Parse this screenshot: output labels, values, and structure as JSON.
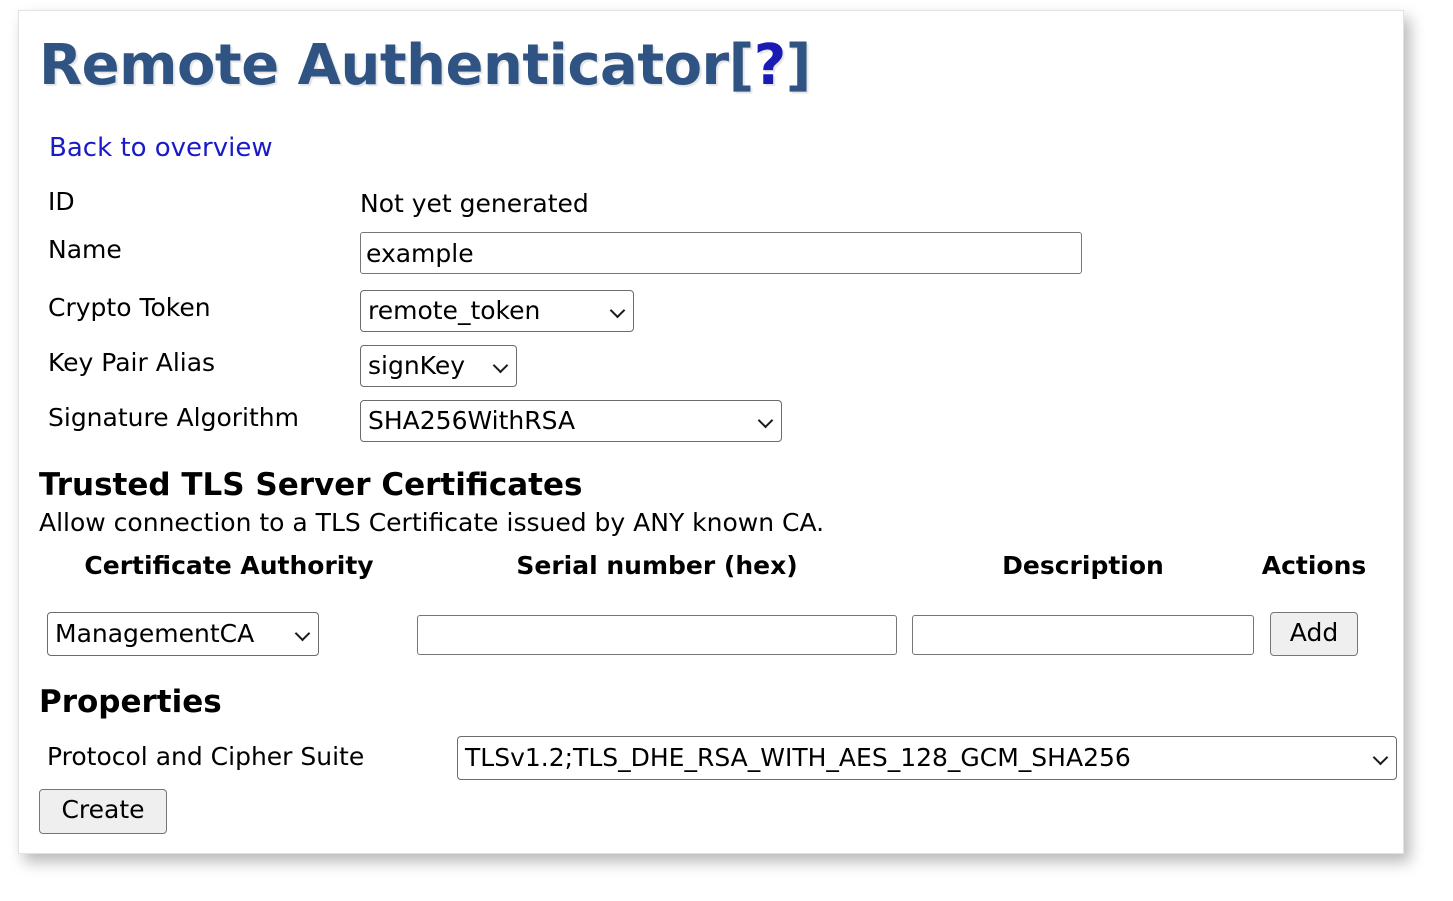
{
  "window": {
    "title_main": "Remote Authenticator",
    "title_help_open": "[",
    "title_help_mark": "?",
    "title_help_close": "]"
  },
  "nav": {
    "back_link": "Back to overview"
  },
  "form": {
    "fields": [
      {
        "label": "ID",
        "type": "static",
        "value": "Not yet generated"
      },
      {
        "label": "Name",
        "type": "text",
        "value": "example",
        "placeholder": ""
      },
      {
        "label": "Crypto Token",
        "type": "select",
        "value": "remote_token"
      },
      {
        "label": "Key Pair Alias",
        "type": "select",
        "value": "signKey"
      },
      {
        "label": "Signature Algorithm",
        "type": "select",
        "value": "SHA256WithRSA"
      }
    ]
  },
  "certificates": {
    "heading": "Trusted TLS Server Certificates",
    "description": "Allow connection to a TLS Certificate issued by ANY known CA.",
    "columns": [
      "Certificate Authority",
      "Serial number (hex)",
      "Description",
      "Actions"
    ],
    "row": {
      "ca_value": "ManagementCA",
      "serial_value": "",
      "serial_placeholder": "",
      "description_value": "",
      "description_placeholder": "",
      "add_label": "Add"
    }
  },
  "properties": {
    "heading": "Properties",
    "protocol_label": "Protocol and Cipher Suite",
    "protocol_value": "TLSv1.2;TLS_DHE_RSA_WITH_AES_128_GCM_SHA256"
  },
  "actions": {
    "create_label": "Create"
  },
  "colors": {
    "title": "#2f5382",
    "link": "#1a1ac8",
    "help_mark": "#1a1ab4",
    "button_face": "#efefef",
    "border": "#767676"
  },
  "icons": {
    "chevron": "chevron-down-icon"
  }
}
